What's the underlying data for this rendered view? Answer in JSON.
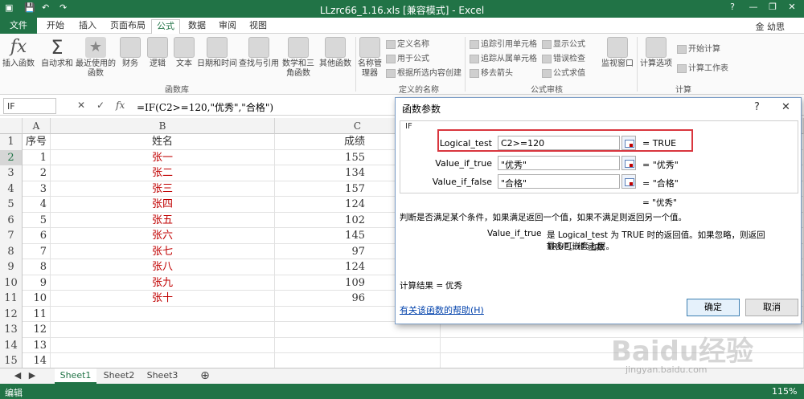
{
  "titlebar": {
    "title": "LLzrc66_1.16.xls  [兼容模式] - Excel",
    "help": "?",
    "min": "—",
    "restore": "❐",
    "close": "✕"
  },
  "tabs": [
    {
      "label": "文件"
    },
    {
      "label": "开始"
    },
    {
      "label": "插入"
    },
    {
      "label": "页面布局"
    },
    {
      "label": "公式"
    },
    {
      "label": "数据"
    },
    {
      "label": "审阅"
    },
    {
      "label": "视图"
    }
  ],
  "user": "金 幼思",
  "ribbon": {
    "insert_function": "插入函数",
    "autosum": "自动求和",
    "recent": "最近使用的函数",
    "financial": "财务",
    "logical": "逻辑",
    "text": "文本",
    "datetime": "日期和时间",
    "lookup": "查找与引用",
    "math": "数学和三角函数",
    "other": "其他函数",
    "name_manager": "名称管理器",
    "define_name": "定义名称",
    "use_in_formula": "用于公式",
    "create_from_selection": "根据所选内容创建",
    "trace_precedents": "追踪引用单元格",
    "trace_dependents": "追踪从属单元格",
    "remove_arrows": "移去箭头",
    "show_formulas": "显示公式",
    "error_checking": "错误检查",
    "evaluate_formula": "公式求值",
    "watch_window": "监视窗口",
    "calc_options": "计算选项",
    "calc_now": "开始计算",
    "calc_sheet": "计算工作表",
    "groups": {
      "library": "函数库",
      "names": "定义的名称",
      "audit": "公式审核",
      "calc": "计算"
    }
  },
  "formula_bar": {
    "name_box": "IF",
    "formula": "=IF(C2>=120,\"优秀\",\"合格\")",
    "cancel": "✕",
    "enter": "✓",
    "fx": "fx"
  },
  "columns": [
    "A",
    "B",
    "C"
  ],
  "rows": [
    {
      "n": "1",
      "a": "序号",
      "b": "姓名",
      "c": "成绩"
    },
    {
      "n": "2",
      "a": "1",
      "b": "张一",
      "c": "155"
    },
    {
      "n": "3",
      "a": "2",
      "b": "张二",
      "c": "134"
    },
    {
      "n": "4",
      "a": "3",
      "b": "张三",
      "c": "157"
    },
    {
      "n": "5",
      "a": "4",
      "b": "张四",
      "c": "124"
    },
    {
      "n": "6",
      "a": "5",
      "b": "张五",
      "c": "102"
    },
    {
      "n": "7",
      "a": "6",
      "b": "张六",
      "c": "145"
    },
    {
      "n": "8",
      "a": "7",
      "b": "张七",
      "c": "97"
    },
    {
      "n": "9",
      "a": "8",
      "b": "张八",
      "c": "124"
    },
    {
      "n": "10",
      "a": "9",
      "b": "张九",
      "c": "109"
    },
    {
      "n": "11",
      "a": "10",
      "b": "张十",
      "c": "96"
    },
    {
      "n": "12",
      "a": "11",
      "b": "",
      "c": ""
    },
    {
      "n": "13",
      "a": "12",
      "b": "",
      "c": ""
    },
    {
      "n": "14",
      "a": "13",
      "b": "",
      "c": ""
    },
    {
      "n": "15",
      "a": "14",
      "b": "",
      "c": ""
    }
  ],
  "sheets": [
    "Sheet1",
    "Sheet2",
    "Sheet3"
  ],
  "status": {
    "mode": "编辑",
    "zoom": "115%"
  },
  "dialog": {
    "title": "函数参数",
    "help": "?",
    "close": "✕",
    "fn": "IF",
    "args": [
      {
        "label": "Logical_test",
        "value": "C2>=120",
        "result": "=  TRUE"
      },
      {
        "label": "Value_if_true",
        "value": "\"优秀\"",
        "result": "=  \"优秀\""
      },
      {
        "label": "Value_if_false",
        "value": "\"合格\"",
        "result": "=  \"合格\""
      }
    ],
    "total": "=  \"优秀\"",
    "desc": "判断是否满足某个条件，如果满足返回一个值，如果不满足则返回另一个值。",
    "arg_name": "Value_if_true",
    "arg_desc1": "是 Logical_test 为 TRUE 时的返回值。如果忽略，则返回 TRUE。IF 函数",
    "arg_desc2": "最多可嵌套七层。",
    "calc_result_label": "计算结果 =",
    "calc_result": "优秀",
    "help_link": "有关该函数的帮助(H)",
    "ok": "确定",
    "cancel": "取消"
  },
  "watermark": {
    "main": "Baidu经验",
    "sub": "jingyan.baidu.com"
  }
}
